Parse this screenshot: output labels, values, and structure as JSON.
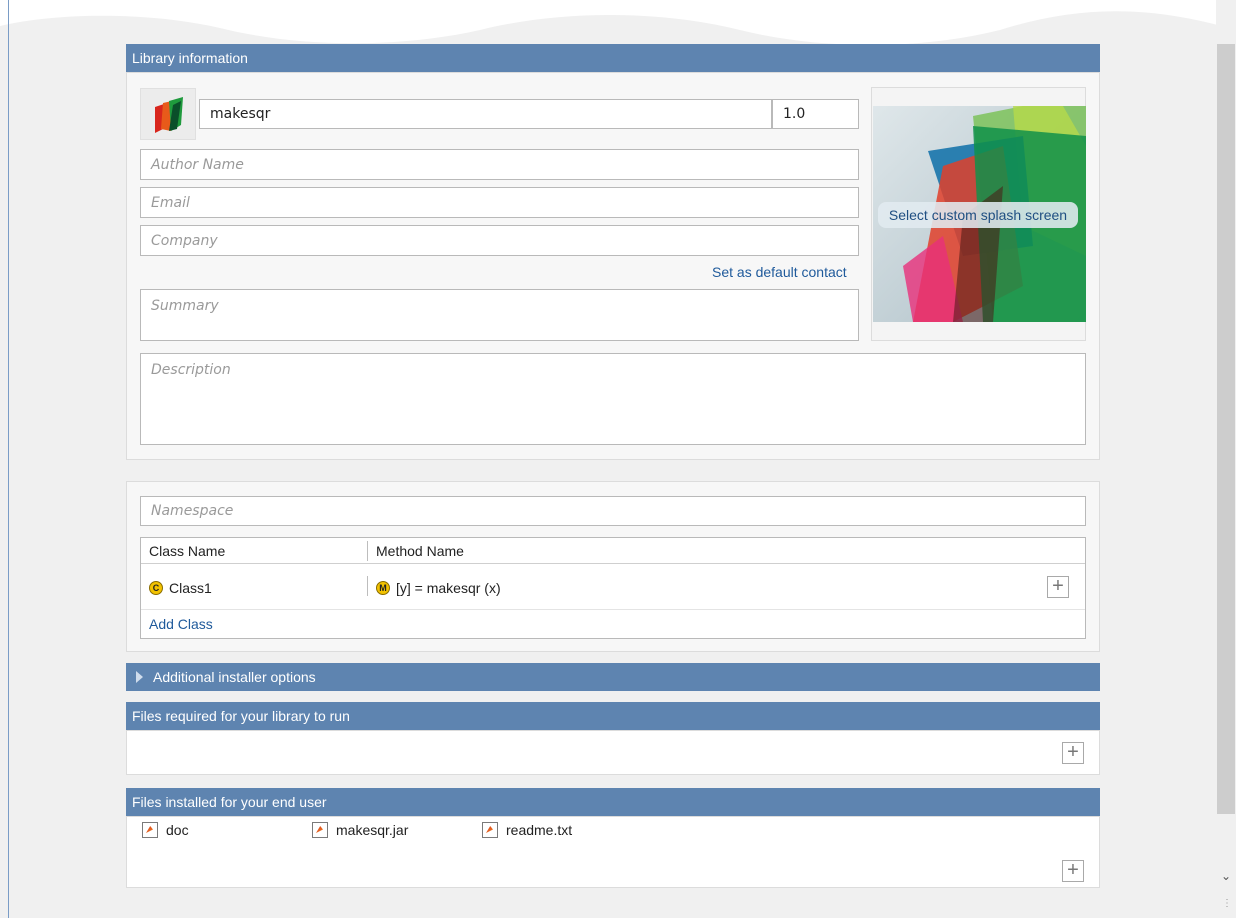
{
  "library_info": {
    "header": "Library information",
    "name_value": "makesqr",
    "version_value": "1.0",
    "author_placeholder": "Author Name",
    "email_placeholder": "Email",
    "company_placeholder": "Company",
    "set_default_contact": "Set as default contact",
    "summary_placeholder": "Summary",
    "description_placeholder": "Description",
    "splash_button": "Select custom splash screen"
  },
  "classes": {
    "namespace_placeholder": "Namespace",
    "col_class": "Class Name",
    "col_method": "Method Name",
    "rows": [
      {
        "class_badge": "C",
        "class_name": "Class1",
        "method_badge": "M",
        "method_signature": "[y] = makesqr (x)"
      }
    ],
    "add_class": "Add Class",
    "add_icon": "plus-icon"
  },
  "additional_options": {
    "header": "Additional installer options"
  },
  "files_required": {
    "header": "Files required for your library to run"
  },
  "files_installed": {
    "header": "Files installed for your end user",
    "items": [
      "doc",
      "makesqr.jar",
      "readme.txt"
    ]
  },
  "colors": {
    "header_bg": "#5e84b0",
    "link": "#1f5a9b",
    "badge": "#f2c200"
  }
}
